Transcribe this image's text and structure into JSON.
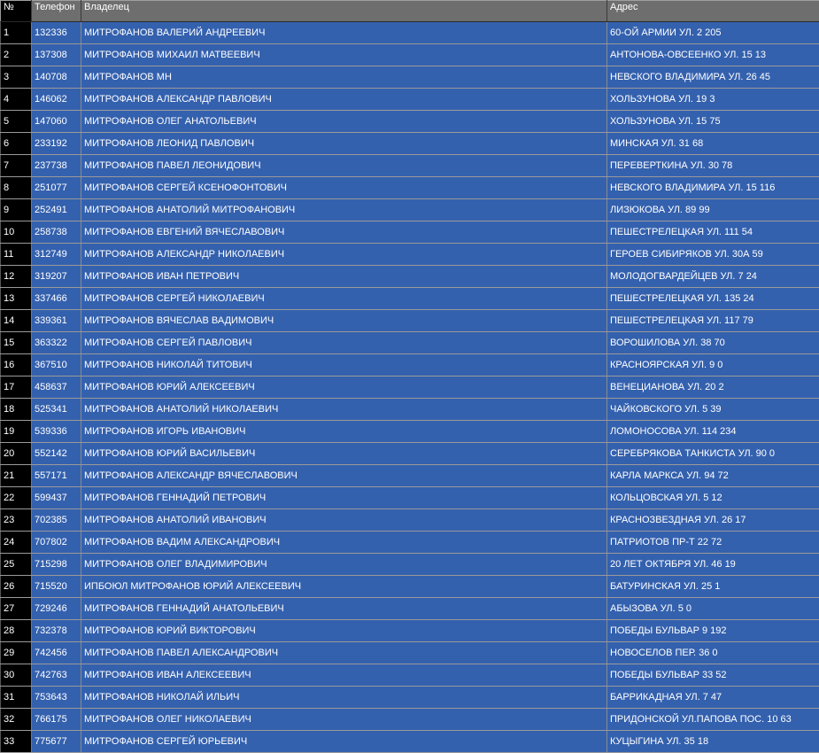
{
  "grid": {
    "columns": [
      "№",
      "Телефон",
      "Владелец",
      "Адрес"
    ],
    "rows": [
      [
        "1",
        "132336",
        "МИТРОФАНОВ ВАЛЕРИЙ АНДРЕЕВИЧ",
        "60-ОЙ АРМИИ УЛ. 2 205"
      ],
      [
        "2",
        "137308",
        "МИТРОФАНОВ МИХАИЛ МАТВЕЕВИЧ",
        "АНТОНОВА-ОВСЕЕНКО УЛ. 15 13"
      ],
      [
        "3",
        "140708",
        "МИТРОФАНОВ МН",
        "НЕВСКОГО ВЛАДИМИРА УЛ. 26 45"
      ],
      [
        "4",
        "146062",
        "МИТРОФАНОВ АЛЕКСАНДР ПАВЛОВИЧ",
        "ХОЛЬЗУНОВА УЛ. 19 3"
      ],
      [
        "5",
        "147060",
        "МИТРОФАНОВ ОЛЕГ АНАТОЛЬЕВИЧ",
        "ХОЛЬЗУНОВА УЛ. 15 75"
      ],
      [
        "6",
        "233192",
        "МИТРОФАНОВ ЛЕОНИД ПАВЛОВИЧ",
        "МИНСКАЯ УЛ. 31 68"
      ],
      [
        "7",
        "237738",
        "МИТРОФАНОВ ПАВЕЛ ЛЕОНИДОВИЧ",
        "ПЕРЕВЕРТКИНА УЛ. 30 78"
      ],
      [
        "8",
        "251077",
        "МИТРОФАНОВ СЕРГЕЙ КСЕНОФОНТОВИЧ",
        "НЕВСКОГО ВЛАДИМИРА УЛ. 15 116"
      ],
      [
        "9",
        "252491",
        "МИТРОФАНОВ АНАТОЛИЙ МИТРОФАНОВИЧ",
        "ЛИЗЮКОВА УЛ. 89 99"
      ],
      [
        "10",
        "258738",
        "МИТРОФАНОВ ЕВГЕНИЙ ВЯЧЕСЛАВОВИЧ",
        "ПЕШЕСТРЕЛЕЦКАЯ УЛ. 111 54"
      ],
      [
        "11",
        "312749",
        "МИТРОФАНОВ АЛЕКСАНДР НИКОЛАЕВИЧ",
        "ГЕРОЕВ СИБИРЯКОВ УЛ. 30А 59"
      ],
      [
        "12",
        "319207",
        "МИТРОФАНОВ ИВАН ПЕТРОВИЧ",
        "МОЛОДОГВАРДЕЙЦЕВ УЛ. 7 24"
      ],
      [
        "13",
        "337466",
        "МИТРОФАНОВ СЕРГЕЙ НИКОЛАЕВИЧ",
        "ПЕШЕСТРЕЛЕЦКАЯ УЛ. 135 24"
      ],
      [
        "14",
        "339361",
        "МИТРОФАНОВ ВЯЧЕСЛАВ ВАДИМОВИЧ",
        "ПЕШЕСТРЕЛЕЦКАЯ УЛ. 117 79"
      ],
      [
        "15",
        "363322",
        "МИТРОФАНОВ СЕРГЕЙ ПАВЛОВИЧ",
        "ВОРОШИЛОВА УЛ. 38 70"
      ],
      [
        "16",
        "367510",
        "МИТРОФАНОВ НИКОЛАЙ ТИТОВИЧ",
        "КРАСНОЯРСКАЯ УЛ. 9 0"
      ],
      [
        "17",
        "458637",
        "МИТРОФАНОВ ЮРИЙ АЛЕКСЕЕВИЧ",
        "ВЕНЕЦИАНОВА УЛ. 20 2"
      ],
      [
        "18",
        "525341",
        "МИТРОФАНОВ АНАТОЛИЙ НИКОЛАЕВИЧ",
        "ЧАЙКОВСКОГО УЛ. 5 39"
      ],
      [
        "19",
        "539336",
        "МИТРОФАНОВ ИГОРЬ ИВАНОВИЧ",
        "ЛОМОНОСОВА УЛ. 114 234"
      ],
      [
        "20",
        "552142",
        "МИТРОФАНОВ ЮРИЙ ВАСИЛЬЕВИЧ",
        "СЕРЕБРЯКОВА ТАНКИСТА УЛ. 90 0"
      ],
      [
        "21",
        "557171",
        "МИТРОФАНОВ АЛЕКСАНДР ВЯЧЕСЛАВОВИЧ",
        "КАРЛА МАРКСА УЛ. 94 72"
      ],
      [
        "22",
        "599437",
        "МИТРОФАНОВ ГЕННАДИЙ ПЕТРОВИЧ",
        "КОЛЬЦОВСКАЯ УЛ. 5 12"
      ],
      [
        "23",
        "702385",
        "МИТРОФАНОВ АНАТОЛИЙ ИВАНОВИЧ",
        "КРАСНОЗВЕЗДНАЯ УЛ. 26 17"
      ],
      [
        "24",
        "707802",
        "МИТРОФАНОВ ВАДИМ АЛЕКСАНДРОВИЧ",
        "ПАТРИОТОВ ПР-Т 22 72"
      ],
      [
        "25",
        "715298",
        "МИТРОФАНОВ ОЛЕГ ВЛАДИМИРОВИЧ",
        "20 ЛЕТ ОКТЯБРЯ УЛ. 46 19"
      ],
      [
        "26",
        "715520",
        "ИПБОЮЛ МИТРОФАНОВ ЮРИЙ АЛЕКСЕЕВИЧ",
        "БАТУРИНСКАЯ УЛ. 25 1"
      ],
      [
        "27",
        "729246",
        "МИТРОФАНОВ ГЕННАДИЙ АНАТОЛЬЕВИЧ",
        "АБЫЗОВА УЛ. 5 0"
      ],
      [
        "28",
        "732378",
        "МИТРОФАНОВ ЮРИЙ ВИКТОРОВИЧ",
        "ПОБЕДЫ БУЛЬВАР 9 192"
      ],
      [
        "29",
        "742456",
        "МИТРОФАНОВ ПАВЕЛ АЛЕКСАНДРОВИЧ",
        "НОВОСЕЛОВ ПЕР. 36 0"
      ],
      [
        "30",
        "742763",
        "МИТРОФАНОВ ИВАН АЛЕКСЕЕВИЧ",
        "ПОБЕДЫ БУЛЬВАР 33 52"
      ],
      [
        "31",
        "753643",
        "МИТРОФАНОВ НИКОЛАЙ ИЛЬИЧ",
        "БАРРИКАДНАЯ УЛ. 7 47"
      ],
      [
        "32",
        "766175",
        "МИТРОФАНОВ ОЛЕГ НИКОЛАЕВИЧ",
        "ПРИДОНСКОЙ УЛ.ПАПОВА ПОС. 10 63"
      ],
      [
        "33",
        "775677",
        "МИТРОФАНОВ СЕРГЕЙ ЮРЬЕВИЧ",
        "КУЦЫГИНА УЛ. 35 18"
      ]
    ]
  },
  "colors": {
    "row_background": "#3461ae",
    "header_background": "#6e6e6e",
    "page_background": "#000000",
    "text": "#ffffff"
  }
}
